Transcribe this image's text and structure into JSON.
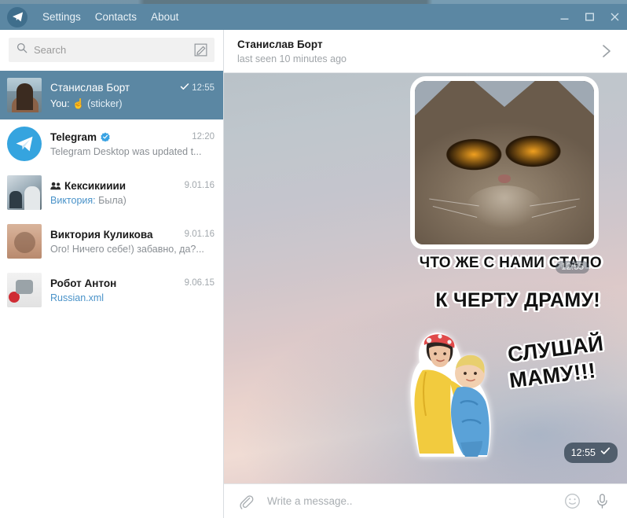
{
  "window": {
    "titlebar_color": "#5b87a3",
    "menu": [
      {
        "label": "Settings",
        "name": "menu-settings"
      },
      {
        "label": "Contacts",
        "name": "menu-contacts"
      },
      {
        "label": "About",
        "name": "menu-about"
      }
    ],
    "controls": {
      "minimize": "minimize-button",
      "maximize": "maximize-button",
      "close": "close-button"
    },
    "app_icon": "telegram-paperplane-icon"
  },
  "search": {
    "placeholder": "Search",
    "value": "",
    "icon": "search-icon",
    "compose_icon": "compose-pencil-icon"
  },
  "chats": [
    {
      "name": "Станислав Борт",
      "time": "12:55",
      "preview_prefix": "You:",
      "preview_emoji": "☝",
      "preview": "(sticker)",
      "selected": true,
      "read_check": true,
      "verified": false,
      "group": false,
      "avatar": "photo-beach-man"
    },
    {
      "name": "Telegram",
      "time": "12:20",
      "preview_prefix": "",
      "preview_emoji": "",
      "preview": "Telegram Desktop was updated t...",
      "selected": false,
      "read_check": false,
      "verified": true,
      "group": false,
      "avatar": "telegram-logo"
    },
    {
      "name": "Кексикииии",
      "time": "9.01.16",
      "preview_prefix": "Виктория:",
      "preview_emoji": "",
      "preview": "Была)",
      "selected": false,
      "read_check": false,
      "verified": false,
      "group": true,
      "avatar": "photo-room"
    },
    {
      "name": "Виктория Куликова",
      "time": "9.01.16",
      "preview_prefix": "",
      "preview_emoji": "",
      "preview": "Ого! Ничего себе!) забавно, да?...",
      "selected": false,
      "read_check": false,
      "verified": false,
      "group": false,
      "avatar": "photo-woman"
    },
    {
      "name": "Робот Антон",
      "time": "9.06.15",
      "preview_prefix": "",
      "preview_emoji": "",
      "preview": "Russian.xml",
      "preview_is_file": true,
      "selected": false,
      "read_check": false,
      "verified": false,
      "group": false,
      "avatar": "photo-robot"
    }
  ],
  "chat_header": {
    "peer_name": "Станислав Борт",
    "peer_status": "last seen 10 minutes ago",
    "arrow_icon": "chevron-right-icon"
  },
  "conversation": {
    "sticker_message": {
      "kind": "sticker",
      "caption_lines": [
        "ЧТО ЖЕ С НАМИ СТАЛО",
        "К ЧЕРТУ ДРАМУ!",
        "СЛУШАЙ",
        "МАМУ!!!"
      ],
      "time": "12:55",
      "overlay_time": "12:55",
      "status_icon": "check-sent-icon"
    }
  },
  "composer": {
    "placeholder": "Write a message..",
    "value": "",
    "attach_icon": "paperclip-icon",
    "emoji_icon": "smiley-icon",
    "mic_icon": "microphone-icon"
  },
  "colors": {
    "accent": "#5b87a3",
    "link": "#4a93c9",
    "selected_row": "#5b87a3",
    "verified_badge": "#3aa3e3"
  }
}
